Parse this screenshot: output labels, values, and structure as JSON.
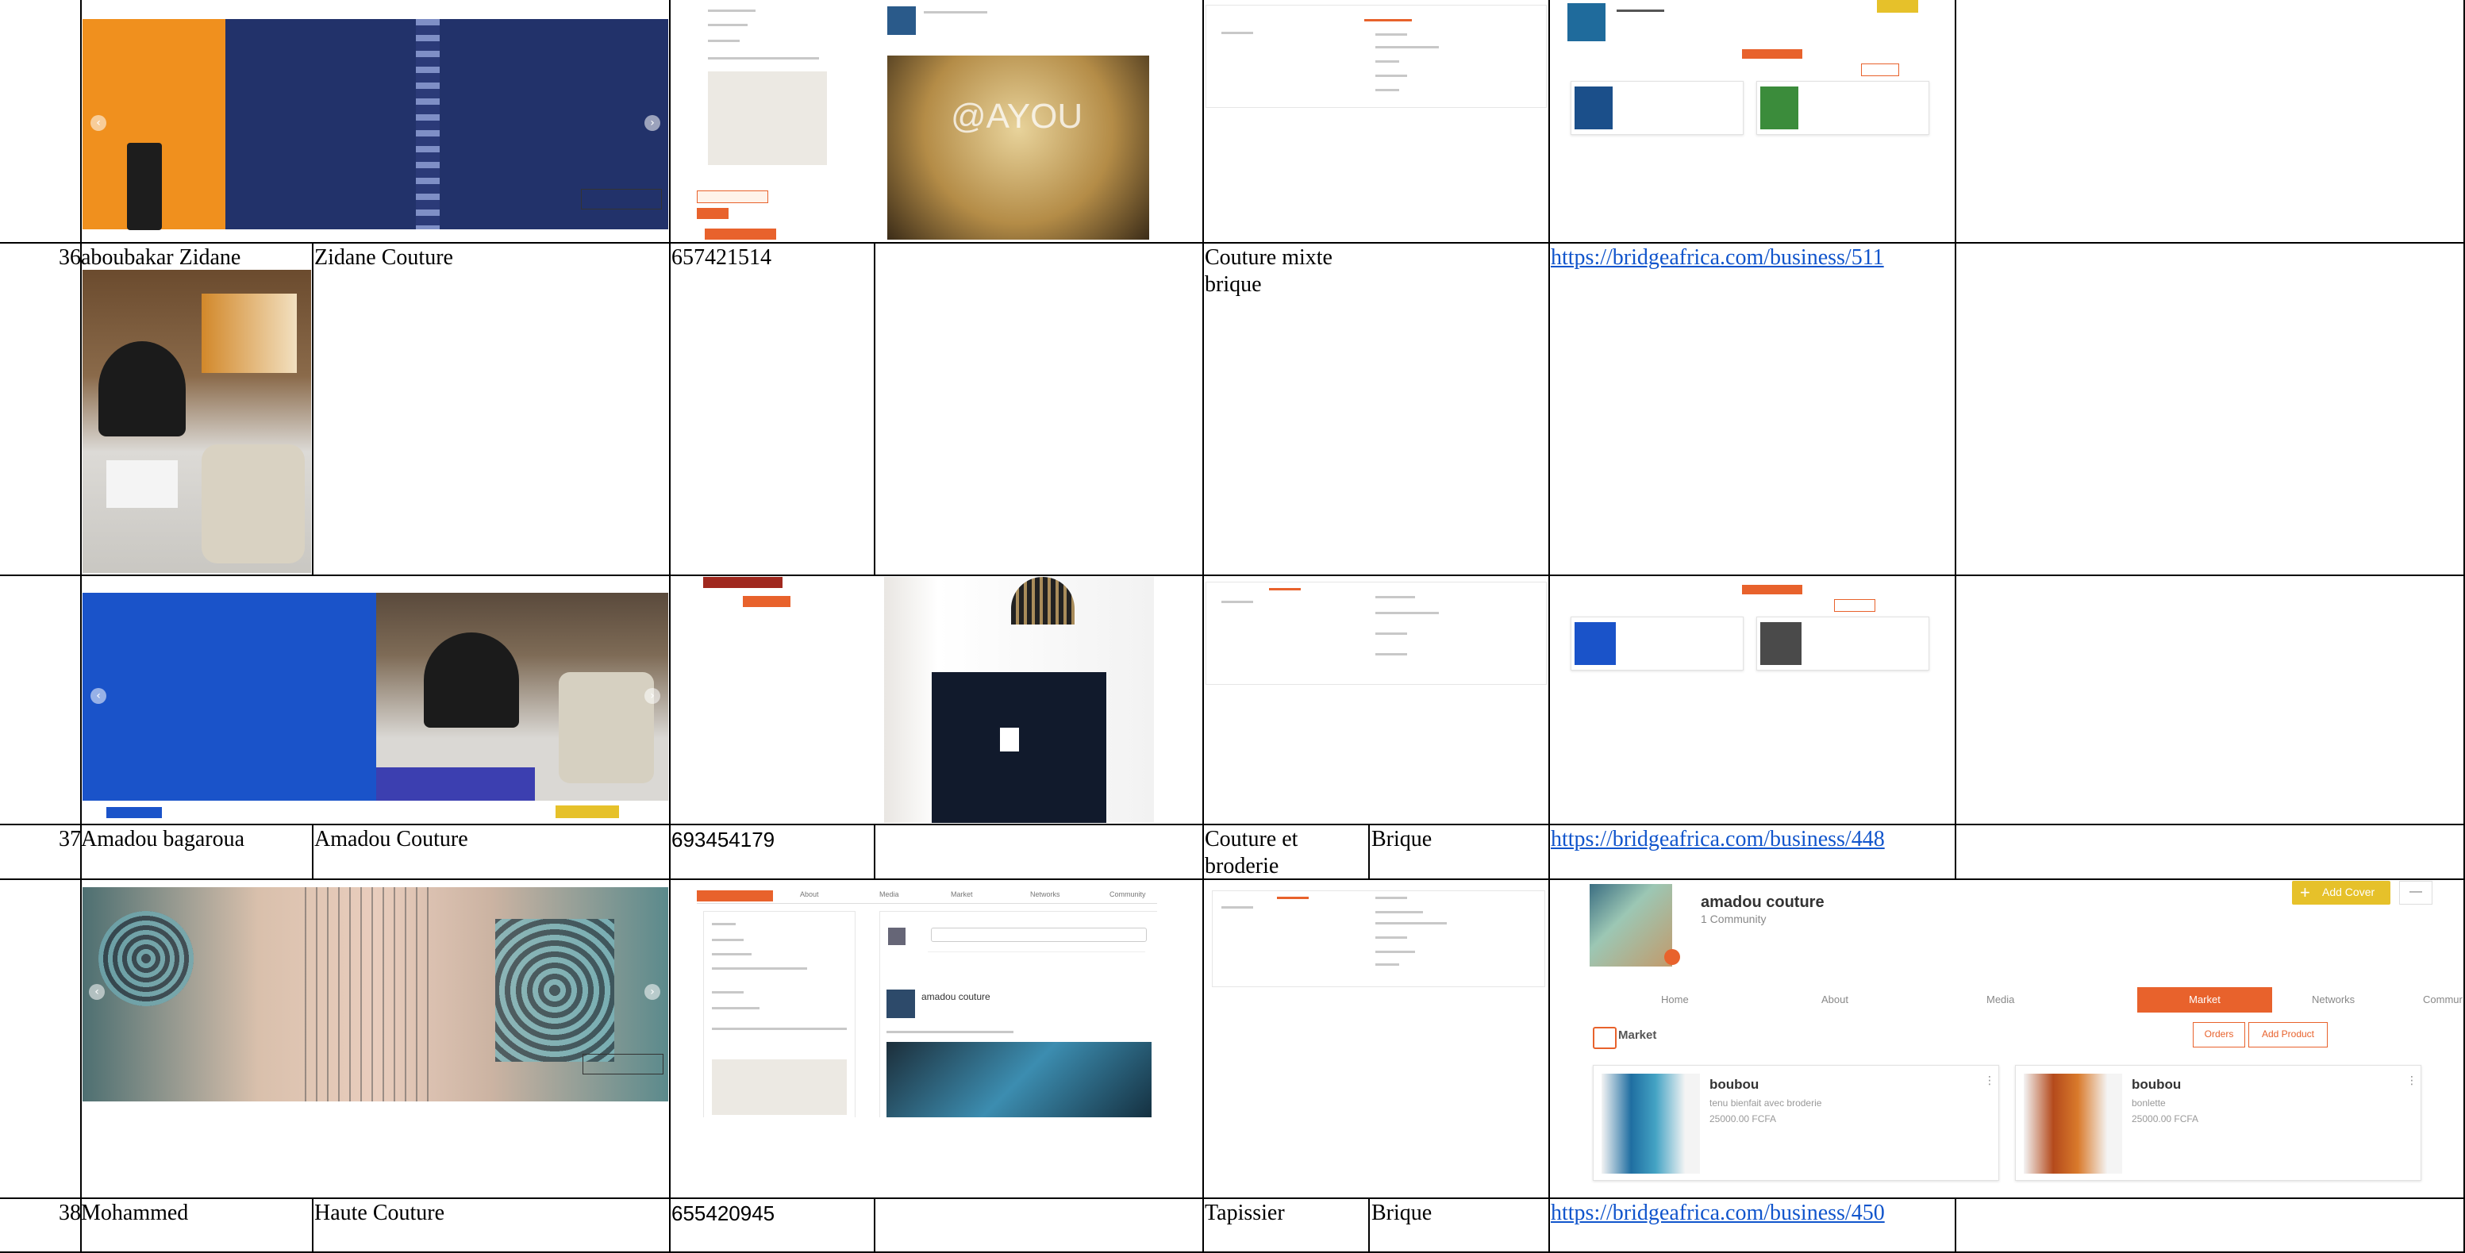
{
  "rows": [
    {
      "num": "36",
      "owner": "aboubakar Zidane",
      "business": "Zidane Couture",
      "phone": "657421514",
      "activity": "Couture mixte\nbrique",
      "zone": "",
      "url": "https://bridgeafrica.com/business/511"
    },
    {
      "num": "37",
      "owner": "Amadou bagaroua",
      "business": "Amadou Couture",
      "phone": "693454179",
      "activity": "Couture et\nbroderie",
      "zone": "Brique",
      "url": "https://bridgeafrica.com/business/448"
    },
    {
      "num": "38",
      "owner": "Mohammed",
      "business": "Haute Couture",
      "phone": "655420945",
      "activity": "Tapissier",
      "zone": "Brique",
      "url": "https://bridgeafrica.com/business/450"
    }
  ],
  "screens": {
    "watermark": "@AYOU",
    "profile_name": "amadou couture",
    "profile_sub": "1 Community",
    "add_cover": "Add Cover",
    "tabs": [
      "Home",
      "About",
      "Media",
      "Market",
      "Networks",
      "Community"
    ],
    "market_label": "Market",
    "orders_btn": "Orders",
    "add_product_btn": "Add Product",
    "products": [
      {
        "name": "boubou",
        "desc": "tenu bienfait avec broderie",
        "price": "25000.00 FCFA"
      },
      {
        "name": "boubou",
        "desc": "bonlette",
        "price": "25000.00 FCFA"
      }
    ]
  },
  "colors": {
    "accent": "#e8622c",
    "yellow": "#e6c12a",
    "link": "#1155cc"
  }
}
